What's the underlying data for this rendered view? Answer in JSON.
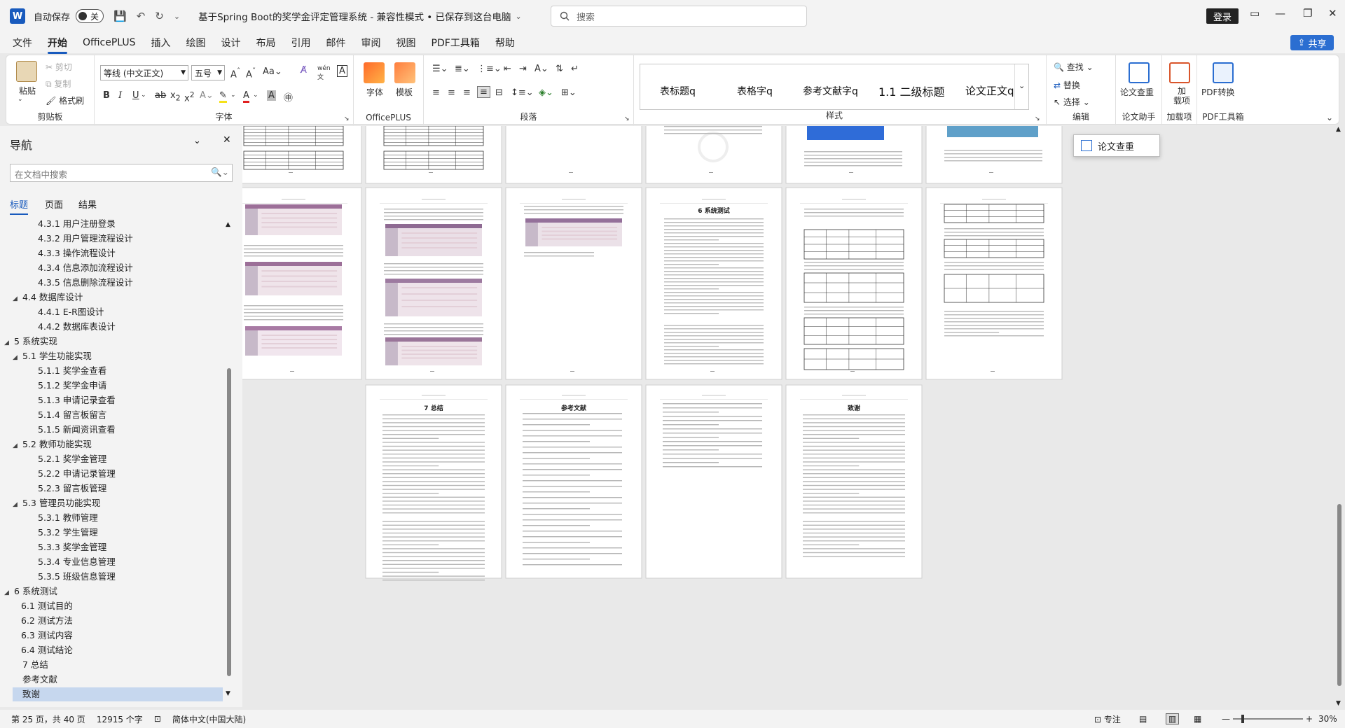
{
  "titlebar": {
    "app_letter": "W",
    "autosave_label": "自动保存",
    "autosave_state": "关",
    "document_title": "基于Spring Boot的奖学金评定管理系统  -  兼容性模式 • 已保存到这台电脑",
    "search_placeholder": "搜索",
    "login_label": "登录"
  },
  "menu": {
    "tabs": [
      "文件",
      "开始",
      "OfficePLUS",
      "插入",
      "绘图",
      "设计",
      "布局",
      "引用",
      "邮件",
      "审阅",
      "视图",
      "PDF工具箱",
      "帮助"
    ],
    "active_tab": "开始",
    "share_label": "共享"
  },
  "ribbon": {
    "clipboard": {
      "paste": "粘贴",
      "cut": "剪切",
      "copy": "复制",
      "format_painter": "格式刷",
      "label": "剪贴板"
    },
    "font": {
      "font_name": "等线 (中文正文)",
      "font_size": "五号",
      "label": "字体"
    },
    "officeplus": {
      "font_btn": "字体",
      "template_btn": "模板",
      "label": "OfficePLUS"
    },
    "paragraph": {
      "label": "段落"
    },
    "styles": {
      "items": [
        "表标题q",
        "表格字q",
        "参考文献字q",
        "1.1  二级标题",
        "论文正文q"
      ],
      "label": "样式"
    },
    "editing": {
      "find": "查找",
      "replace": "替换",
      "select": "选择",
      "label": "编辑"
    },
    "paper_check": {
      "btn": "论文查重",
      "label": "论文助手"
    },
    "addins": {
      "btn": "加\n载项",
      "label": "加载项"
    },
    "pdf": {
      "btn": "PDF转换",
      "label": "PDF工具箱"
    }
  },
  "nav": {
    "title": "导航",
    "search_placeholder": "在文档中搜索",
    "tabs": [
      "标题",
      "页面",
      "结果"
    ],
    "active_tab": "标题",
    "items": [
      {
        "text": "4.3.1 用户注册登录",
        "level": 3,
        "arrow": ""
      },
      {
        "text": "4.3.2 用户管理流程设计",
        "level": 3,
        "arrow": ""
      },
      {
        "text": "4.3.3 操作流程设计",
        "level": 3,
        "arrow": ""
      },
      {
        "text": "4.3.4 信息添加流程设计",
        "level": 3,
        "arrow": ""
      },
      {
        "text": "4.3.5 信息删除流程设计",
        "level": 3,
        "arrow": ""
      },
      {
        "text": "4.4 数据库设计",
        "level": 2,
        "arrow": "◢"
      },
      {
        "text": "4.4.1 E-R图设计",
        "level": 3,
        "arrow": ""
      },
      {
        "text": "4.4.2 数据库表设计",
        "level": 3,
        "arrow": ""
      },
      {
        "text": "5 系统实现",
        "level": 1,
        "arrow": "◢"
      },
      {
        "text": "5.1 学生功能实现",
        "level": 2,
        "arrow": "◢"
      },
      {
        "text": "5.1.1 奖学金查看",
        "level": 3,
        "arrow": ""
      },
      {
        "text": "5.1.2 奖学金申请",
        "level": 3,
        "arrow": ""
      },
      {
        "text": "5.1.3 申请记录查看",
        "level": 3,
        "arrow": ""
      },
      {
        "text": "5.1.4 留言板留言",
        "level": 3,
        "arrow": ""
      },
      {
        "text": "5.1.5 新闻资讯查看",
        "level": 3,
        "arrow": ""
      },
      {
        "text": "5.2 教师功能实现",
        "level": 2,
        "arrow": "◢"
      },
      {
        "text": "5.2.1 奖学金管理",
        "level": 3,
        "arrow": ""
      },
      {
        "text": "5.2.2 申请记录管理",
        "level": 3,
        "arrow": ""
      },
      {
        "text": "5.2.3 留言板管理",
        "level": 3,
        "arrow": ""
      },
      {
        "text": "5.3 管理员功能实现",
        "level": 2,
        "arrow": "◢"
      },
      {
        "text": "5.3.1 教师管理",
        "level": 3,
        "arrow": ""
      },
      {
        "text": "5.3.2 学生管理",
        "level": 3,
        "arrow": ""
      },
      {
        "text": "5.3.3 奖学金管理",
        "level": 3,
        "arrow": ""
      },
      {
        "text": "5.3.4 专业信息管理",
        "level": 3,
        "arrow": ""
      },
      {
        "text": "5.3.5 班级信息管理",
        "level": 3,
        "arrow": ""
      },
      {
        "text": "6 系统测试",
        "level": 1,
        "arrow": "◢"
      },
      {
        "text": "6.1 测试目的",
        "level": 2,
        "arrow": ""
      },
      {
        "text": "6.2 测试方法",
        "level": 2,
        "arrow": ""
      },
      {
        "text": "6.3 测试内容",
        "level": 2,
        "arrow": ""
      },
      {
        "text": "6.4 测试结论",
        "level": 2,
        "arrow": ""
      },
      {
        "text": "7 总结",
        "level": 1,
        "arrow": ""
      },
      {
        "text": "参考文献",
        "level": 1,
        "arrow": ""
      },
      {
        "text": "致谢",
        "level": 1,
        "arrow": "",
        "selected": true
      }
    ]
  },
  "pages": {
    "row2_headings": [
      "6  系统测试",
      "",
      "",
      ""
    ],
    "row3_headings": [
      "7  总结",
      "参考文献",
      "",
      "致谢"
    ],
    "tooltip": "论文查重"
  },
  "statusbar": {
    "page": "第 25 页，共 40 页",
    "words": "12915 个字",
    "language": "简体中文(中国大陆)",
    "focus": "专注",
    "zoom": "30%"
  }
}
